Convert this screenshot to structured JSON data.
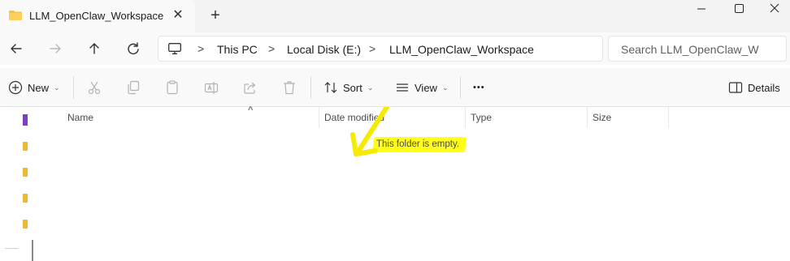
{
  "tab": {
    "title": "LLM_OpenClaw_Workspace",
    "icon": "folder-icon",
    "close_glyph": "✕",
    "new_tab_glyph": "+"
  },
  "window": {
    "minimize": "minimize-icon",
    "maximize": "maximize-icon",
    "close": "close-icon"
  },
  "navigation": {
    "back": "back-arrow-icon",
    "forward": "forward-arrow-icon",
    "up": "up-arrow-icon",
    "refresh": "refresh-icon"
  },
  "address": {
    "pc_icon": "computer-icon",
    "separator": ">",
    "breadcrumbs": [
      "This PC",
      "Local Disk (E:)",
      "LLM_OpenClaw_Workspace"
    ]
  },
  "search": {
    "placeholder": "Search LLM_OpenClaw_W"
  },
  "commandbar": {
    "new_label": "New",
    "sort_label": "Sort",
    "view_label": "View",
    "more_glyph": "•••",
    "details_label": "Details",
    "disabled_icons": [
      "cut-icon",
      "copy-icon",
      "paste-icon",
      "rename-icon",
      "share-icon",
      "delete-icon"
    ]
  },
  "columns": {
    "name": "Name",
    "date_modified": "Date modified",
    "type": "Type",
    "size": "Size",
    "sort_glyph": "^"
  },
  "empty_message": "This folder is empty.",
  "colors": {
    "highlight": "#ffff1a",
    "folder": "#f8c33c",
    "accent": "#0067c0"
  }
}
